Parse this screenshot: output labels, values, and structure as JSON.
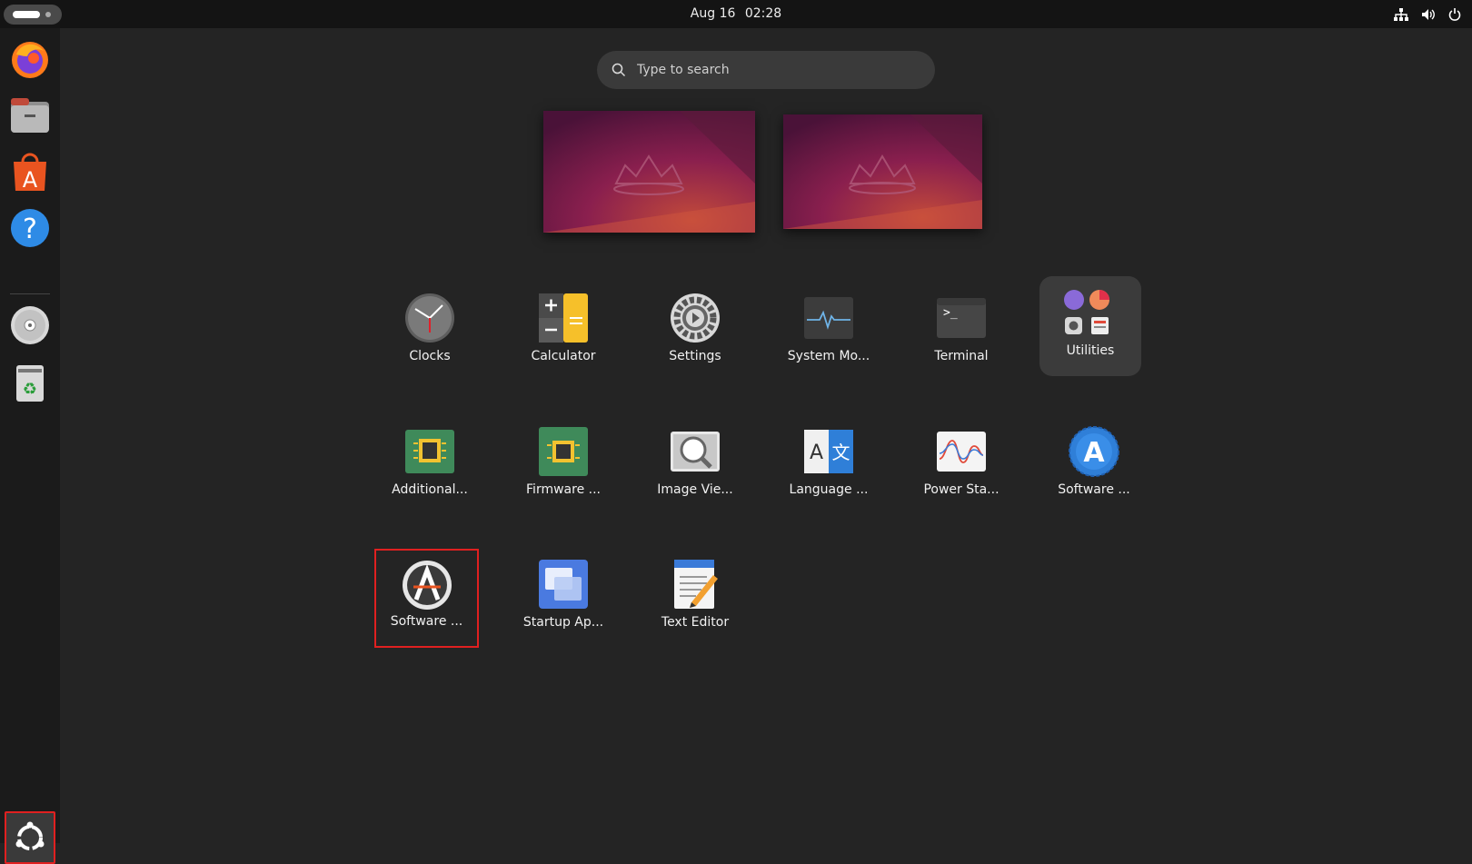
{
  "topbar": {
    "date": "Aug 16",
    "time": "02:28"
  },
  "search": {
    "placeholder": "Type to search"
  },
  "apps": [
    {
      "label": "Clocks",
      "icon": "clock-icon"
    },
    {
      "label": "Calculator",
      "icon": "calculator-icon"
    },
    {
      "label": "Settings",
      "icon": "gear-icon"
    },
    {
      "label": "System Mo...",
      "icon": "system-monitor-icon"
    },
    {
      "label": "Terminal",
      "icon": "terminal-icon"
    },
    {
      "label": "Utilities",
      "icon": "utilities-folder-icon"
    },
    {
      "label": "Additional...",
      "icon": "chip-icon"
    },
    {
      "label": "Firmware ...",
      "icon": "firmware-chip-icon"
    },
    {
      "label": "Image Vie...",
      "icon": "image-viewer-icon"
    },
    {
      "label": "Language ...",
      "icon": "language-icon"
    },
    {
      "label": "Power Sta...",
      "icon": "power-statistics-icon"
    },
    {
      "label": "Software ...",
      "icon": "software-updater-icon"
    },
    {
      "label": "Software ...",
      "icon": "software-properties-icon"
    },
    {
      "label": "Startup Ap...",
      "icon": "startup-apps-icon"
    },
    {
      "label": "Text Editor",
      "icon": "text-editor-icon"
    }
  ],
  "dock": [
    "firefox-icon",
    "files-icon",
    "app-center-icon",
    "help-icon",
    "disc-icon",
    "trash-icon",
    "show-apps-icon"
  ],
  "colors": {
    "accent": "#e95420",
    "highlight": "#e02020"
  }
}
